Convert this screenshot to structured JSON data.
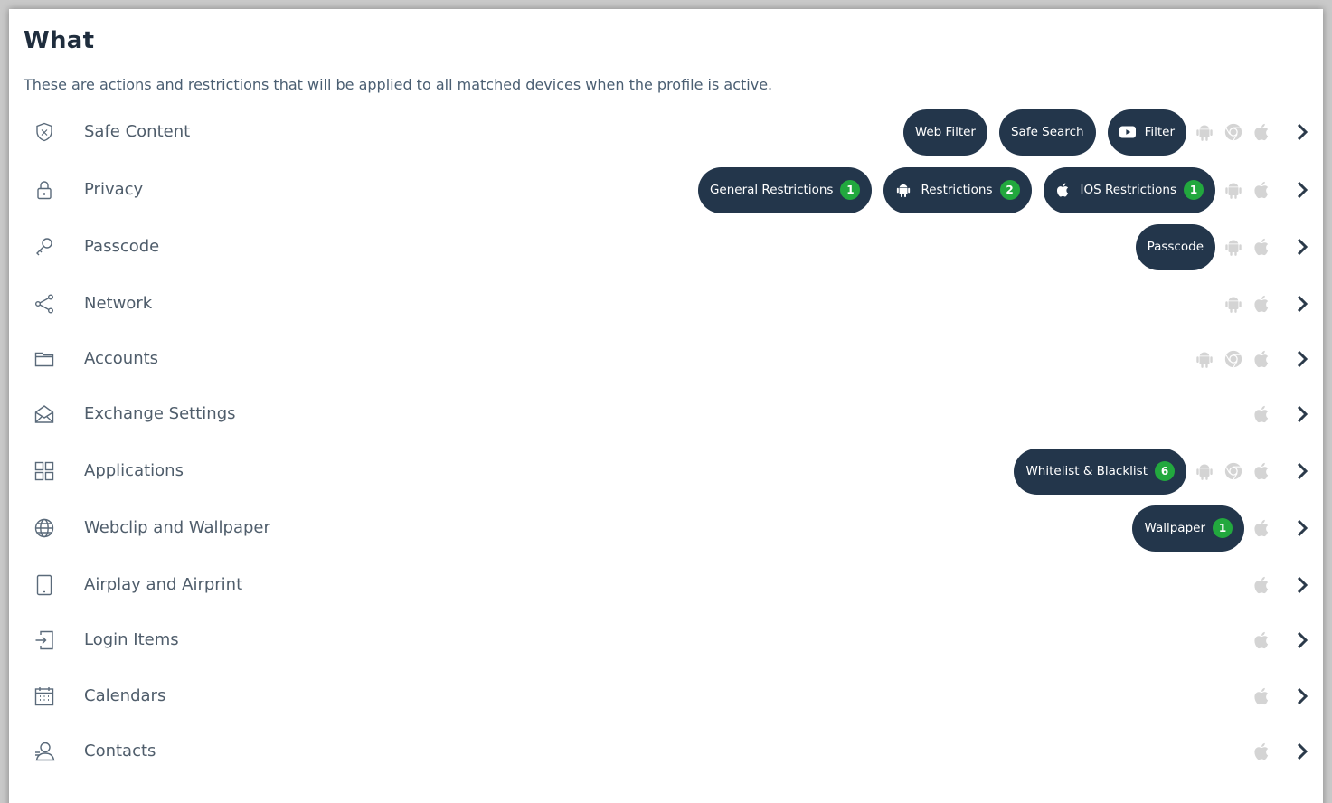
{
  "section": {
    "title": "What",
    "description": "These are actions and restrictions that will be applied to all matched devices when the profile is active."
  },
  "colors": {
    "pill_bg": "#23364b",
    "badge_bg": "#22a83e",
    "platform_icon": "#d4d4d4",
    "chevron": "#2b3a4a"
  },
  "rows": [
    {
      "label": "Safe Content",
      "icon": "shield-icon",
      "pills": [
        {
          "label": "Web Filter"
        },
        {
          "label": "Safe Search"
        },
        {
          "label": "Filter",
          "icon": "youtube-icon"
        }
      ],
      "platforms": [
        "android",
        "chrome",
        "apple"
      ]
    },
    {
      "label": "Privacy",
      "icon": "lock-icon",
      "pills": [
        {
          "label": "General Restrictions",
          "badge": "1"
        },
        {
          "label": "Restrictions",
          "badge": "2",
          "icon": "android-icon"
        },
        {
          "label": "IOS Restrictions",
          "badge": "1",
          "icon": "apple-icon"
        }
      ],
      "platforms": [
        "android",
        "apple"
      ]
    },
    {
      "label": "Passcode",
      "icon": "key-icon",
      "pills": [
        {
          "label": "Passcode"
        }
      ],
      "platforms": [
        "android",
        "apple"
      ]
    },
    {
      "label": "Network",
      "icon": "share-icon",
      "pills": [],
      "platforms": [
        "android",
        "apple"
      ]
    },
    {
      "label": "Accounts",
      "icon": "folder-icon",
      "pills": [],
      "platforms": [
        "android",
        "chrome",
        "apple"
      ]
    },
    {
      "label": "Exchange Settings",
      "icon": "envelope-icon",
      "pills": [],
      "platforms": [
        "apple"
      ]
    },
    {
      "label": "Applications",
      "icon": "grid-icon",
      "pills": [
        {
          "label": "Whitelist & Blacklist",
          "badge": "6"
        }
      ],
      "platforms": [
        "android",
        "chrome",
        "apple"
      ]
    },
    {
      "label": "Webclip and Wallpaper",
      "icon": "globe-icon",
      "pills": [
        {
          "label": "Wallpaper",
          "badge": "1"
        }
      ],
      "platforms": [
        "apple"
      ]
    },
    {
      "label": "Airplay and Airprint",
      "icon": "tablet-icon",
      "pills": [],
      "platforms": [
        "apple"
      ]
    },
    {
      "label": "Login Items",
      "icon": "login-icon",
      "pills": [],
      "platforms": [
        "apple"
      ]
    },
    {
      "label": "Calendars",
      "icon": "calendar-icon",
      "pills": [],
      "platforms": [
        "apple"
      ]
    },
    {
      "label": "Contacts",
      "icon": "contact-icon",
      "pills": [],
      "platforms": [
        "apple"
      ]
    }
  ]
}
